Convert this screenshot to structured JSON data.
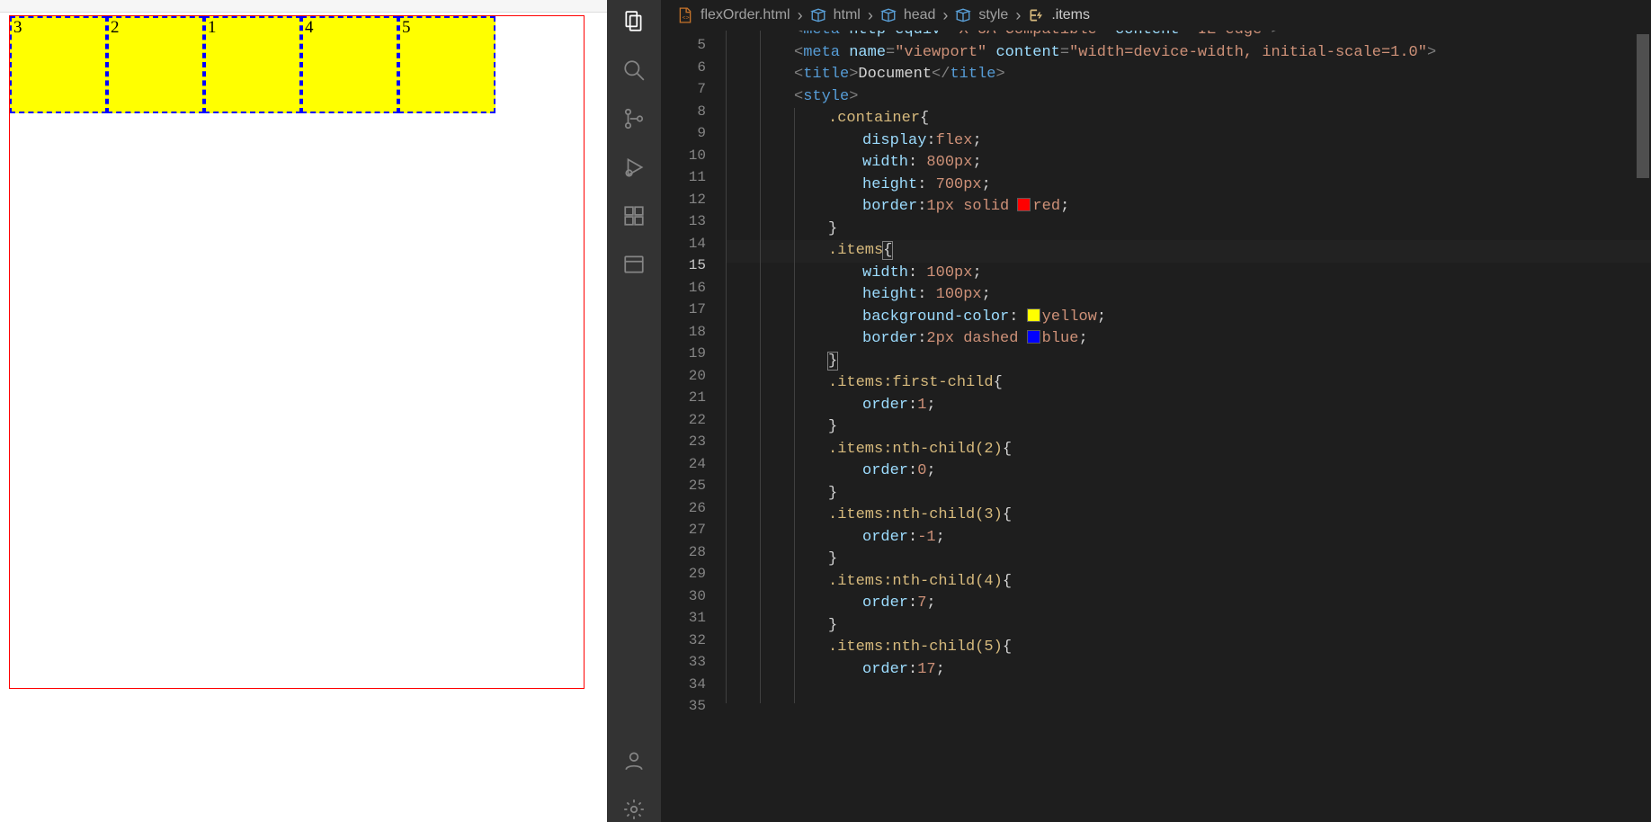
{
  "preview": {
    "box_labels": [
      "3",
      "2",
      "1",
      "4",
      "5"
    ]
  },
  "activity": {
    "items": [
      {
        "name": "explorer",
        "active": true
      },
      {
        "name": "search",
        "active": false
      },
      {
        "name": "source-control",
        "active": false
      },
      {
        "name": "run-debug",
        "active": false
      },
      {
        "name": "extensions",
        "active": false
      },
      {
        "name": "panel",
        "active": false
      }
    ],
    "bottom": [
      {
        "name": "accounts"
      },
      {
        "name": "manage"
      }
    ]
  },
  "breadcrumbs": {
    "segs": [
      {
        "icon": "file",
        "label": "flexOrder.html"
      },
      {
        "icon": "symbol",
        "label": "html"
      },
      {
        "icon": "symbol",
        "label": "head"
      },
      {
        "icon": "symbol",
        "label": "style"
      },
      {
        "icon": "sel",
        "label": ".items"
      }
    ]
  },
  "editor": {
    "first_line_no": 6,
    "active_line_no": 15,
    "lines": [
      {
        "n": 5,
        "indent": 2,
        "segs": [
          [
            "punct",
            "<"
          ],
          [
            "tag",
            "meta"
          ],
          [
            "text",
            " "
          ],
          [
            "attr",
            "http-equiv"
          ],
          [
            "punct",
            "="
          ],
          [
            "str",
            "\"X-UA-Compatible\""
          ],
          [
            "text",
            " "
          ],
          [
            "attr",
            "content"
          ],
          [
            "punct",
            "="
          ],
          [
            "str",
            "\"IE=edge\""
          ],
          [
            "punct",
            ">"
          ]
        ],
        "clip": true
      },
      {
        "n": 6,
        "indent": 2,
        "segs": [
          [
            "punct",
            "<"
          ],
          [
            "tag",
            "meta"
          ],
          [
            "text",
            " "
          ],
          [
            "attr",
            "name"
          ],
          [
            "punct",
            "="
          ],
          [
            "str",
            "\"viewport\""
          ],
          [
            "text",
            " "
          ],
          [
            "attr",
            "content"
          ],
          [
            "punct",
            "="
          ],
          [
            "str",
            "\"width=device-width, initial-scale=1.0\""
          ],
          [
            "punct",
            ">"
          ]
        ]
      },
      {
        "n": 7,
        "indent": 2,
        "segs": [
          [
            "punct",
            "<"
          ],
          [
            "tag",
            "title"
          ],
          [
            "punct",
            ">"
          ],
          [
            "hl",
            "Document"
          ],
          [
            "punct",
            "</"
          ],
          [
            "tag",
            "title"
          ],
          [
            "punct",
            ">"
          ]
        ]
      },
      {
        "n": 8,
        "indent": 2,
        "segs": [
          [
            "punct",
            "<"
          ],
          [
            "tag",
            "style"
          ],
          [
            "punct",
            ">"
          ]
        ]
      },
      {
        "n": 9,
        "indent": 3,
        "segs": [
          [
            "sel",
            ".container"
          ],
          [
            "brace",
            "{"
          ]
        ]
      },
      {
        "n": 10,
        "indent": 4,
        "segs": [
          [
            "prop",
            "display"
          ],
          [
            "text",
            ":"
          ],
          [
            "val",
            "flex"
          ],
          [
            "text",
            ";"
          ]
        ]
      },
      {
        "n": 11,
        "indent": 4,
        "segs": [
          [
            "prop",
            "width"
          ],
          [
            "text",
            ": "
          ],
          [
            "val",
            "800px"
          ],
          [
            "text",
            ";"
          ]
        ]
      },
      {
        "n": 12,
        "indent": 4,
        "segs": [
          [
            "prop",
            "height"
          ],
          [
            "text",
            ": "
          ],
          [
            "val",
            "700px"
          ],
          [
            "text",
            ";"
          ]
        ]
      },
      {
        "n": 13,
        "indent": 4,
        "segs": [
          [
            "prop",
            "border"
          ],
          [
            "text",
            ":"
          ],
          [
            "val",
            "1px"
          ],
          [
            "text",
            " "
          ],
          [
            "val",
            "solid"
          ],
          [
            "text",
            " "
          ],
          [
            "swatch",
            "#ff0000"
          ],
          [
            "val",
            "red"
          ],
          [
            "text",
            ";"
          ]
        ]
      },
      {
        "n": 14,
        "indent": 3,
        "segs": [
          [
            "brace",
            "}"
          ]
        ]
      },
      {
        "n": 15,
        "indent": 3,
        "segs": [
          [
            "sel",
            ".items"
          ],
          [
            "bracematch",
            "{"
          ]
        ],
        "active": true
      },
      {
        "n": 16,
        "indent": 4,
        "segs": [
          [
            "prop",
            "width"
          ],
          [
            "text",
            ": "
          ],
          [
            "val",
            "100px"
          ],
          [
            "text",
            ";"
          ]
        ]
      },
      {
        "n": 17,
        "indent": 4,
        "segs": [
          [
            "prop",
            "height"
          ],
          [
            "text",
            ": "
          ],
          [
            "val",
            "100px"
          ],
          [
            "text",
            ";"
          ]
        ]
      },
      {
        "n": 18,
        "indent": 4,
        "segs": [
          [
            "prop",
            "background-color"
          ],
          [
            "text",
            ": "
          ],
          [
            "swatch",
            "#ffff00"
          ],
          [
            "val",
            "yellow"
          ],
          [
            "text",
            ";"
          ]
        ]
      },
      {
        "n": 19,
        "indent": 4,
        "segs": [
          [
            "prop",
            "border"
          ],
          [
            "text",
            ":"
          ],
          [
            "val",
            "2px"
          ],
          [
            "text",
            " "
          ],
          [
            "val",
            "dashed"
          ],
          [
            "text",
            " "
          ],
          [
            "swatch",
            "#0000ff"
          ],
          [
            "val",
            "blue"
          ],
          [
            "text",
            ";"
          ]
        ]
      },
      {
        "n": 20,
        "indent": 3,
        "segs": [
          [
            "bracematch",
            "}"
          ]
        ]
      },
      {
        "n": 21,
        "indent": 3,
        "segs": [
          [
            "sel",
            ".items:first-child"
          ],
          [
            "brace",
            "{"
          ]
        ]
      },
      {
        "n": 22,
        "indent": 4,
        "segs": [
          [
            "prop",
            "order"
          ],
          [
            "text",
            ":"
          ],
          [
            "val",
            "1"
          ],
          [
            "text",
            ";"
          ]
        ]
      },
      {
        "n": 23,
        "indent": 3,
        "segs": [
          [
            "brace",
            "}"
          ]
        ]
      },
      {
        "n": 24,
        "indent": 3,
        "segs": [
          [
            "sel",
            ".items:nth-child(2)"
          ],
          [
            "brace",
            "{"
          ]
        ]
      },
      {
        "n": 25,
        "indent": 4,
        "segs": [
          [
            "prop",
            "order"
          ],
          [
            "text",
            ":"
          ],
          [
            "val",
            "0"
          ],
          [
            "text",
            ";"
          ]
        ]
      },
      {
        "n": 26,
        "indent": 3,
        "segs": [
          [
            "brace",
            "}"
          ]
        ]
      },
      {
        "n": 27,
        "indent": 3,
        "segs": [
          [
            "sel",
            ".items:nth-child(3)"
          ],
          [
            "brace",
            "{"
          ]
        ]
      },
      {
        "n": 28,
        "indent": 4,
        "segs": [
          [
            "prop",
            "order"
          ],
          [
            "text",
            ":"
          ],
          [
            "val",
            "-1"
          ],
          [
            "text",
            ";"
          ]
        ]
      },
      {
        "n": 29,
        "indent": 3,
        "segs": [
          [
            "brace",
            "}"
          ]
        ]
      },
      {
        "n": 30,
        "indent": 3,
        "segs": [
          [
            "sel",
            ".items:nth-child(4)"
          ],
          [
            "brace",
            "{"
          ]
        ]
      },
      {
        "n": 31,
        "indent": 4,
        "segs": [
          [
            "prop",
            "order"
          ],
          [
            "text",
            ":"
          ],
          [
            "val",
            "7"
          ],
          [
            "text",
            ";"
          ]
        ]
      },
      {
        "n": 32,
        "indent": 3,
        "segs": [
          [
            "brace",
            "}"
          ]
        ]
      },
      {
        "n": 33,
        "indent": 3,
        "segs": [
          [
            "sel",
            ".items:nth-child(5)"
          ],
          [
            "brace",
            "{"
          ]
        ]
      },
      {
        "n": 34,
        "indent": 4,
        "segs": [
          [
            "prop",
            "order"
          ],
          [
            "text",
            ":"
          ],
          [
            "val",
            "17"
          ],
          [
            "text",
            ";"
          ]
        ]
      },
      {
        "n": 35,
        "indent": 3,
        "segs": []
      }
    ]
  }
}
